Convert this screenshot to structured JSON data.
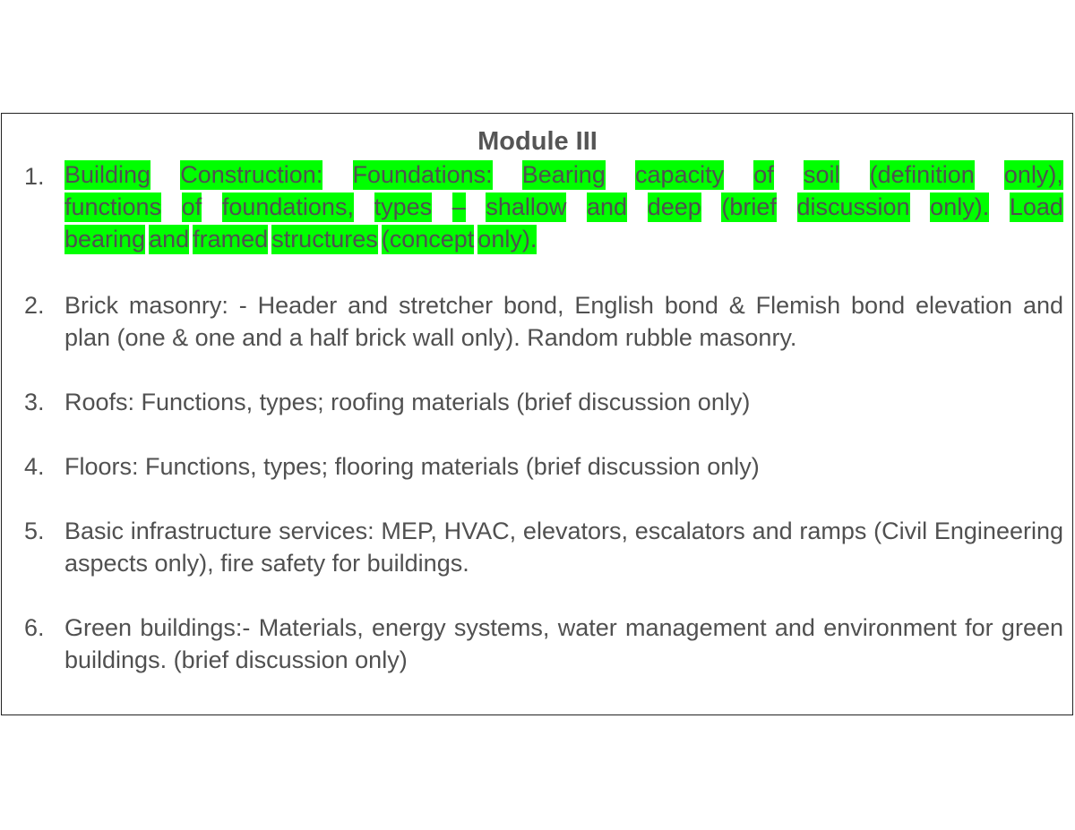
{
  "document": {
    "title": "Module III",
    "highlight_color": "#00ff00",
    "items": [
      {
        "number": "1.",
        "lines": [
          "Building Construction: Foundations: Bearing capacity of soil (definition only),",
          "functions of foundations, types – shallow and deep (brief discussion only). Load",
          "bearing and framed structures (concept only)."
        ],
        "highlighted": true
      },
      {
        "number": "2.",
        "text": "Brick masonry: - Header and stretcher bond, English bond & Flemish bond elevation and plan (one & one and a half brick wall only). Random rubble masonry."
      },
      {
        "number": "3.",
        "text": "Roofs: Functions, types; roofing materials (brief discussion only)"
      },
      {
        "number": "4.",
        "text": "Floors: Functions, types; flooring materials (brief discussion only)"
      },
      {
        "number": "5.",
        "text": "Basic infrastructure services: MEP, HVAC, elevators, escalators and ramps (Civil Engineering aspects only), fire safety for buildings."
      },
      {
        "number": "6.",
        "text": "Green buildings:- Materials, energy systems, water management and environment for green buildings. (brief discussion only)"
      }
    ]
  }
}
